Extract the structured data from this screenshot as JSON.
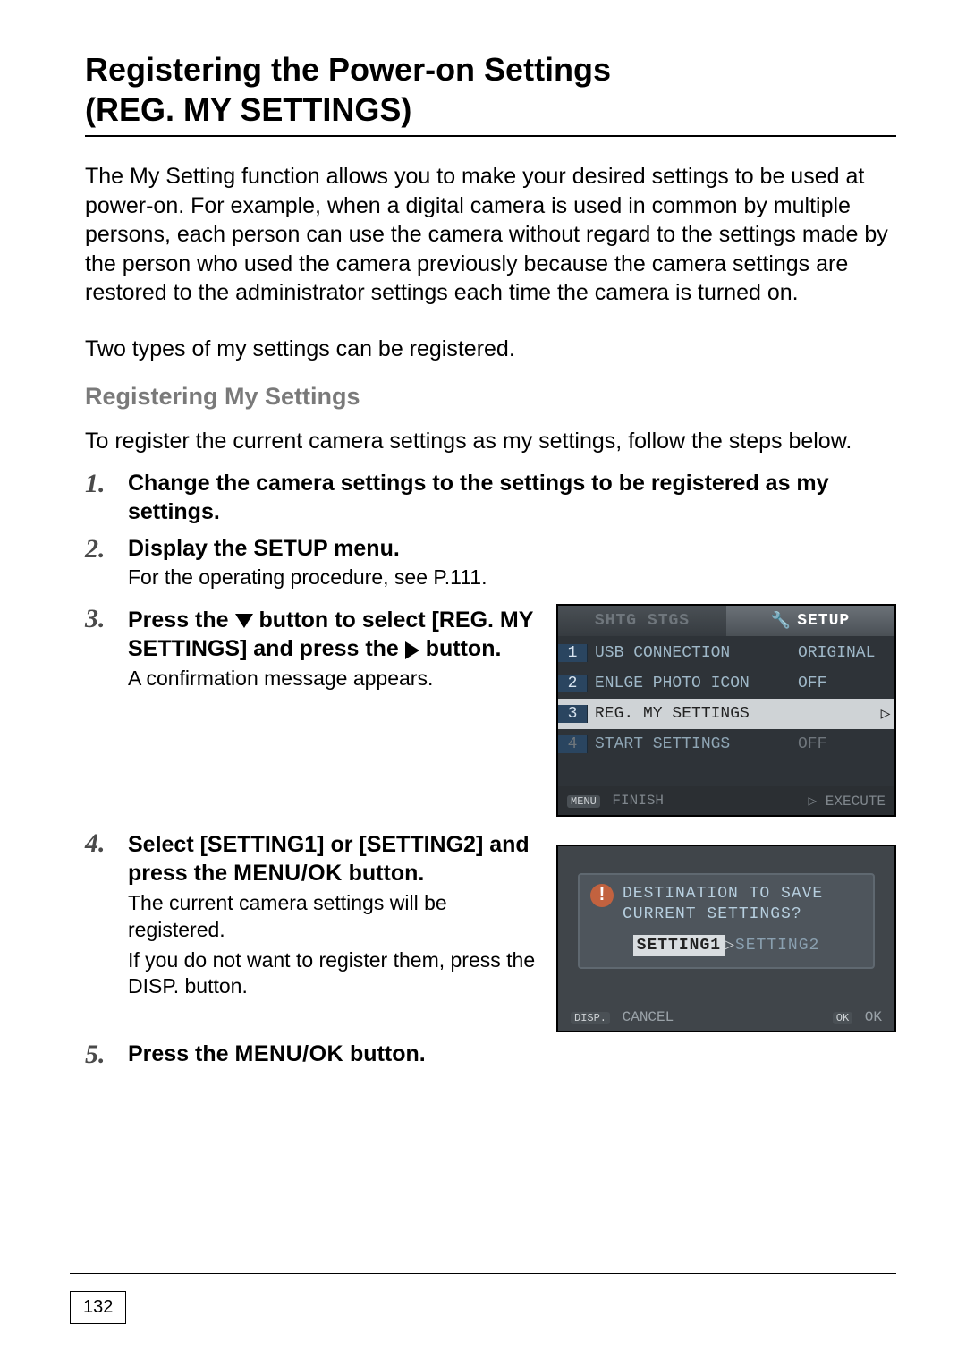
{
  "title_line1": "Registering the Power-on Settings",
  "title_line2": "(REG. MY SETTINGS)",
  "intro": "The My Setting function allows you to make your desired settings to be used at power-on. For example, when a digital camera is used in common by multiple persons, each person can use the camera without regard to the settings made by the person who used the camera previously because the camera settings are restored to the administrator settings each time the camera is turned on.",
  "intro2": "Two types of my settings can be registered.",
  "subhead": "Registering My Settings",
  "subintro": "To register the current camera settings as my settings, follow the steps below.",
  "steps": {
    "s1": {
      "title": "Change the camera settings to the settings to be registered as my settings."
    },
    "s2": {
      "title": "Display the SETUP menu.",
      "text": "For the operating procedure, see P.111."
    },
    "s3": {
      "title_a": "Press the ",
      "title_b": " button to select [REG. MY SETTINGS] and press the ",
      "title_c": " button.",
      "text": "A confirmation message appears."
    },
    "s4": {
      "title_a": "Select [SETTING1] or [SETTING2] and press the ",
      "menuok": "MENU/OK",
      "title_b": " button.",
      "text1": "The current camera settings will be registered.",
      "text2": "If you do not want to register them, press the DISP. button."
    },
    "s5": {
      "title_a": "Press the ",
      "menuok": "MENU/OK",
      "title_b": " button."
    }
  },
  "lcd1": {
    "tab_inactive": "SHTG STGS",
    "tab_active": "SETUP",
    "rows": [
      {
        "num": "1",
        "label": "USB CONNECTION",
        "value": "ORIGINAL"
      },
      {
        "num": "2",
        "label": "ENLGE PHOTO ICON",
        "value": "OFF"
      },
      {
        "num": "3",
        "label": "REG. MY SETTINGS",
        "value": "",
        "highlight": true
      },
      {
        "num": "4",
        "label": "START SETTINGS",
        "value": "OFF",
        "dim": true
      }
    ],
    "footer_left_key": "MENU",
    "footer_left": "FINISH",
    "footer_right": "EXECUTE"
  },
  "lcd2": {
    "msg1": "DESTINATION TO SAVE",
    "msg2": "CURRENT SETTINGS?",
    "btn1": "SETTING1",
    "btn2": "SETTING2",
    "footer_left_key": "DISP.",
    "footer_left": "CANCEL",
    "footer_right_key": "OK",
    "footer_right": "OK"
  },
  "page_number": "132"
}
